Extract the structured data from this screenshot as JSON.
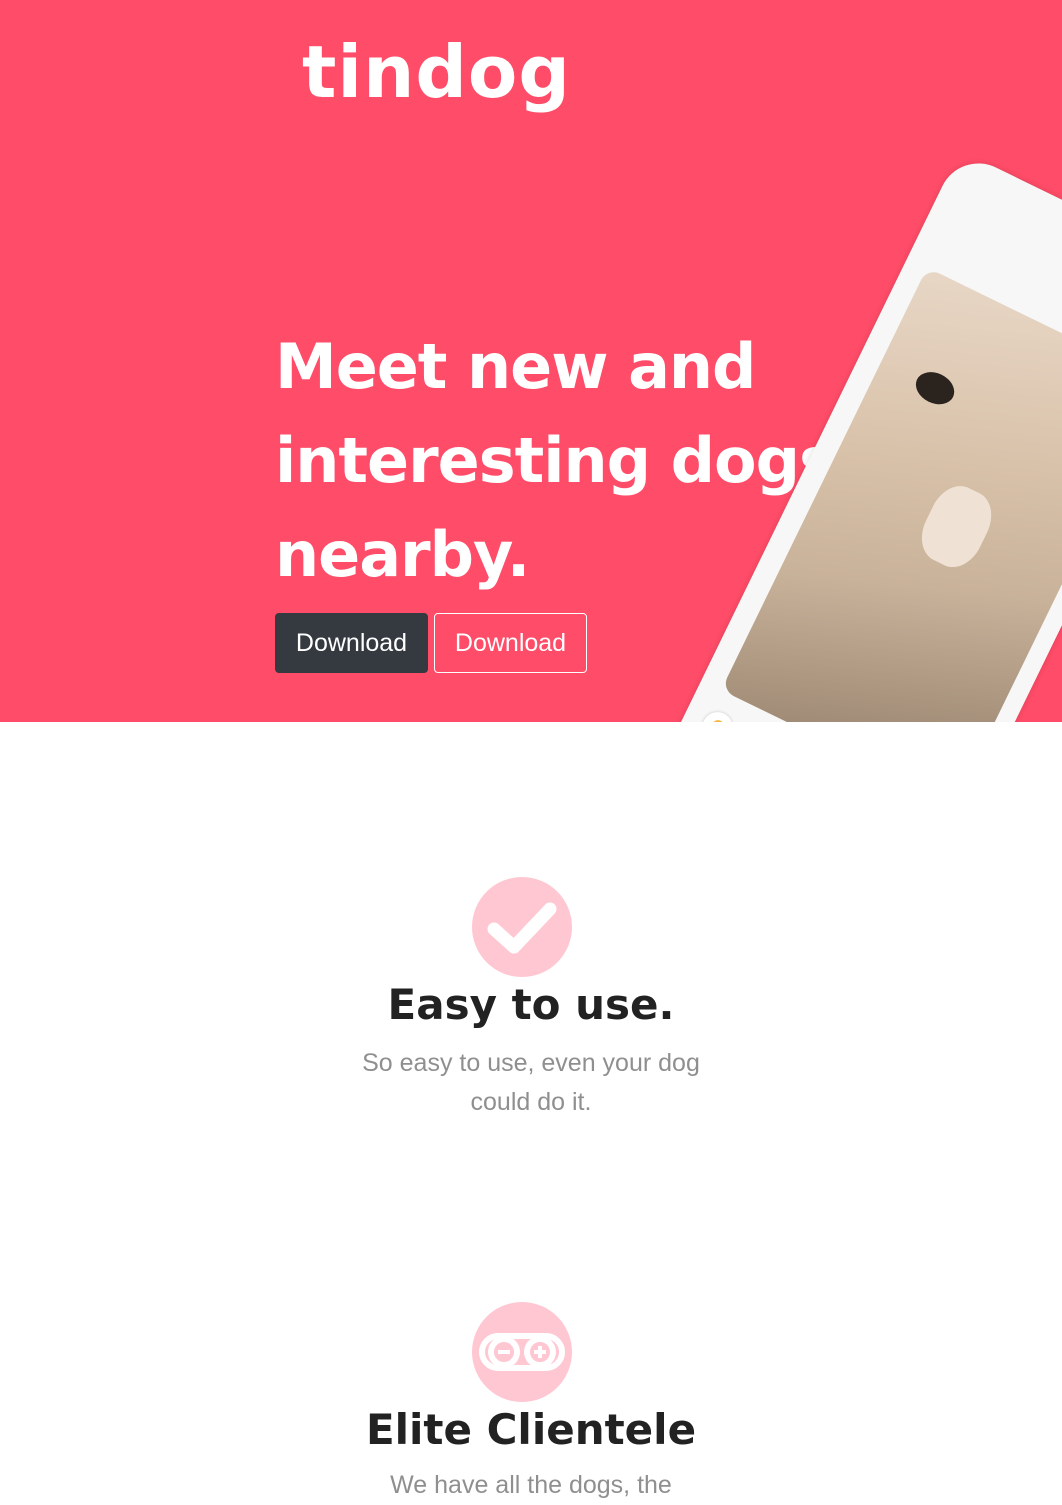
{
  "header": {
    "brand": "tindog",
    "headline": "Meet new and interesting dogs nearby.",
    "buttons": {
      "primary_label": "Download",
      "secondary_label": "Download"
    }
  },
  "features": [
    {
      "icon": "check-icon",
      "title": "Easy to use.",
      "text": "So easy to use, even your dog could do it."
    },
    {
      "icon": "infinity-icon",
      "title": "Elite Clientele",
      "text": "We have all the dogs, the"
    }
  ],
  "colors": {
    "hero_bg": "#ff4c68",
    "dark_button": "#343a40",
    "icon_circle": "#ffc7d1",
    "title_text": "#222222",
    "body_text": "#8f8f8f"
  }
}
